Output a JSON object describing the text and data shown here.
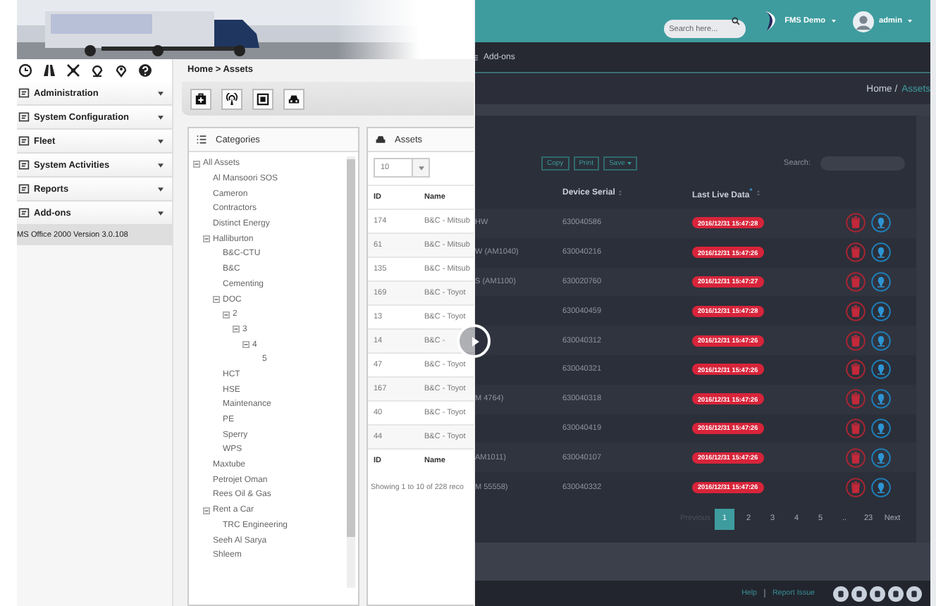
{
  "left_app": {
    "breadcrumb": "Home > Assets",
    "menu": [
      {
        "label": "Administration"
      },
      {
        "label": "System Configuration"
      },
      {
        "label": "Fleet"
      },
      {
        "label": "System Activities"
      },
      {
        "label": "Reports"
      },
      {
        "label": "Add-ons"
      }
    ],
    "version": "MS Office 2000 Version 3.0.108",
    "categories": {
      "title": "Categories",
      "tree": [
        {
          "label": "All Assets",
          "expanded": true,
          "children": [
            {
              "label": "Al Mansoori SOS"
            },
            {
              "label": "Cameron"
            },
            {
              "label": "Contractors"
            },
            {
              "label": "Distinct Energy"
            },
            {
              "label": "Halliburton",
              "expanded": true,
              "children": [
                {
                  "label": "B&C-CTU"
                },
                {
                  "label": "B&C"
                },
                {
                  "label": "Cementing"
                },
                {
                  "label": "DOC",
                  "expanded": true,
                  "children": [
                    {
                      "label": "2",
                      "expanded": true,
                      "children": [
                        {
                          "label": "3",
                          "expanded": true,
                          "children": [
                            {
                              "label": "4",
                              "expanded": true,
                              "children": [
                                {
                                  "label": "5"
                                }
                              ]
                            }
                          ]
                        }
                      ]
                    }
                  ]
                },
                {
                  "label": "HCT"
                },
                {
                  "label": "HSE"
                },
                {
                  "label": "Maintenance"
                },
                {
                  "label": "PE"
                },
                {
                  "label": "Sperry"
                },
                {
                  "label": "WPS"
                }
              ]
            },
            {
              "label": "Maxtube"
            },
            {
              "label": "Petrojet Oman"
            },
            {
              "label": "Rees Oil & Gas"
            },
            {
              "label": "Rent a Car",
              "expanded": true,
              "children": [
                {
                  "label": "TRC Engineering"
                }
              ]
            },
            {
              "label": "Seeh Al Sarya"
            },
            {
              "label": "Shleem"
            }
          ]
        }
      ]
    },
    "assets": {
      "title": "Assets",
      "page_size": "10",
      "columns": [
        "ID",
        "Name"
      ],
      "rows": [
        {
          "id": "174",
          "name": "B&C - Mitsub"
        },
        {
          "id": "61",
          "name": "B&C - Mitsub"
        },
        {
          "id": "135",
          "name": "B&C - Mitsub"
        },
        {
          "id": "169",
          "name": "B&C - Toyot"
        },
        {
          "id": "13",
          "name": "B&C - Toyot"
        },
        {
          "id": "14",
          "name": "B&C -"
        },
        {
          "id": "47",
          "name": "B&C - Toyot"
        },
        {
          "id": "167",
          "name": "B&C - Toyot"
        },
        {
          "id": "40",
          "name": "B&C - Toyot"
        },
        {
          "id": "44",
          "name": "B&C - Toyot"
        }
      ],
      "footer_columns": [
        "ID",
        "Name"
      ],
      "info": "Showing 1 to 10 of 228 reco"
    }
  },
  "right_app": {
    "search": {
      "placeholder": "Search here..."
    },
    "brand": "FMS Demo",
    "user": "admin",
    "nav": "Add-ons",
    "breadcrumb": {
      "home": "Home /",
      "current": "Assets"
    },
    "buttons": [
      "Copy",
      "Print",
      "Save"
    ],
    "search_label": "Search:",
    "columns": [
      "Device Serial",
      "Last Live Data$^{*}$"
    ],
    "rows": [
      {
        "name": "HW",
        "serial": "630040586",
        "last_live": "2016/12/31 15:47:28"
      },
      {
        "name": "W (AM1040)",
        "serial": "630040216",
        "last_live": "2016/12/31 15:47:26"
      },
      {
        "name": "S (AM1100)",
        "serial": "630020760",
        "last_live": "2016/12/31 15:47:27"
      },
      {
        "serial": "630040459",
        "last_live": "2016/12/31 15:47:28"
      },
      {
        "serial": "630040312",
        "last_live": "2016/12/31 15:47:26"
      },
      {
        "serial": "630040321",
        "last_live": "2016/12/31 15:47:26"
      },
      {
        "name": "M 4764)",
        "serial": "630040318",
        "last_live": "2016/12/31 15:47:26"
      },
      {
        "serial": "630040419",
        "last_live": "2016/12/31 15:47:26"
      },
      {
        "name": "AM1011)",
        "serial": "630040107",
        "last_live": "2016/12/31 15:47:26"
      },
      {
        "name": "M 55558)",
        "serial": "630040332",
        "last_live": "2016/12/31 15:47:26"
      }
    ],
    "pagination": [
      {
        "label": "Previous",
        "selected": false,
        "disabled": true
      },
      {
        "label": "1",
        "selected": true,
        "disabled": false
      },
      {
        "label": "2",
        "selected": false,
        "disabled": false
      },
      {
        "label": "3",
        "selected": false,
        "disabled": false
      },
      {
        "label": "4",
        "selected": false,
        "disabled": false
      },
      {
        "label": "5",
        "selected": false,
        "disabled": false
      },
      {
        "label": "..",
        "selected": false,
        "disabled": false
      },
      {
        "label": "23",
        "selected": false,
        "disabled": false
      },
      {
        "label": "Next",
        "selected": false,
        "disabled": false
      }
    ],
    "footer_links": [
      "Help",
      "Report Issue"
    ]
  }
}
